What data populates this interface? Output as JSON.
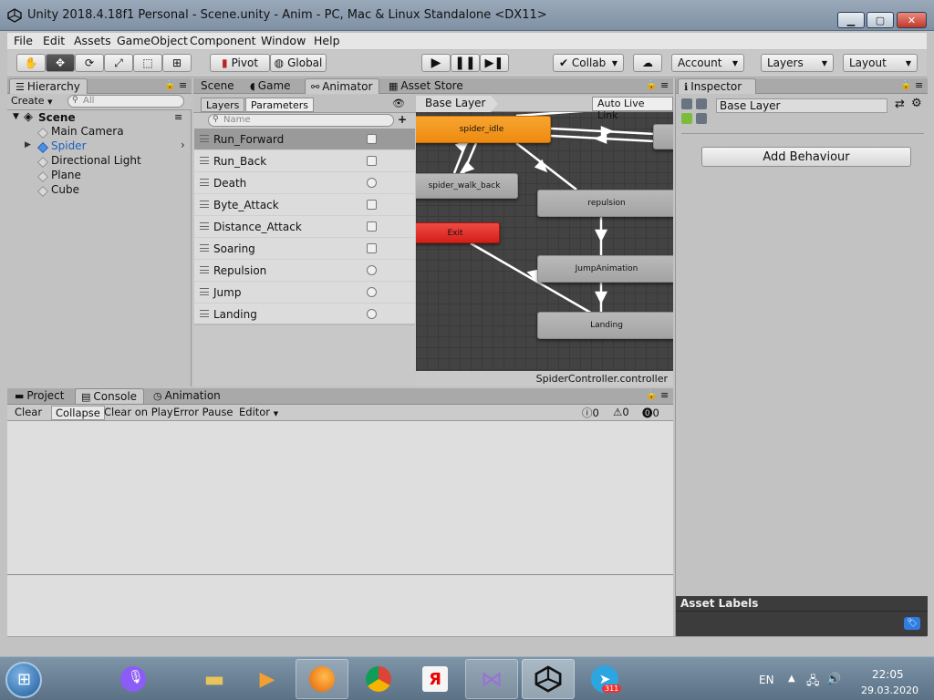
{
  "window": {
    "title": "Unity 2018.4.18f1 Personal - Scene.unity - Anim - PC, Mac & Linux Standalone <DX11>",
    "minimize_icon": "minimize-icon",
    "maximize_icon": "maximize-icon",
    "close_icon": "close-icon"
  },
  "menu": [
    "File",
    "Edit",
    "Assets",
    "GameObject",
    "Component",
    "Window",
    "Help"
  ],
  "toolbar": {
    "tools": [
      "hand-tool-icon",
      "move-tool-icon",
      "rotate-tool-icon",
      "scale-tool-icon",
      "rect-tool-icon",
      "transform-tool-icon"
    ],
    "pivot": "Pivot",
    "global": "Global",
    "collab": "Collab",
    "account": "Account",
    "layers": "Layers",
    "layout": "Layout"
  },
  "hierarchy": {
    "tab": "Hierarchy",
    "create": "Create",
    "search_placeholder": "All",
    "scene": "Scene",
    "items": [
      "Main Camera",
      "Spider",
      "Directional Light",
      "Plane",
      "Cube"
    ]
  },
  "center_tabs": [
    "Scene",
    "Game",
    "Animator",
    "Asset Store"
  ],
  "animator": {
    "subtabs": [
      "Layers",
      "Parameters"
    ],
    "search_placeholder": "Name",
    "breadcrumb": "Base Layer",
    "auto_live_link": "Auto Live Link",
    "controller": "SpiderController.controller",
    "parameters": [
      {
        "name": "Run_Forward",
        "type": "bool"
      },
      {
        "name": "Run_Back",
        "type": "bool"
      },
      {
        "name": "Death",
        "type": "trigger"
      },
      {
        "name": "Byte_Attack",
        "type": "bool"
      },
      {
        "name": "Distance_Attack",
        "type": "bool"
      },
      {
        "name": "Soaring",
        "type": "bool"
      },
      {
        "name": "Repulsion",
        "type": "trigger"
      },
      {
        "name": "Jump",
        "type": "trigger"
      },
      {
        "name": "Landing",
        "type": "trigger"
      }
    ],
    "states": {
      "idle": "spider_idle",
      "walk_back": "spider_walk_back",
      "exit": "Exit",
      "repulsion": "repulsion",
      "jump": "JumpAnimation",
      "landing": "Landing"
    }
  },
  "inspector": {
    "tab": "Inspector",
    "layer_name": "Base Layer",
    "add_behaviour": "Add Behaviour",
    "asset_labels": "Asset Labels"
  },
  "bottom_tabs": [
    "Project",
    "Console",
    "Animation"
  ],
  "console": {
    "buttons": [
      "Clear",
      "Collapse",
      "Clear on Play",
      "Error Pause",
      "Editor"
    ],
    "info_count": "0",
    "warning_count": "0",
    "error_count": "0"
  },
  "taskbar": {
    "language": "EN",
    "time": "22:05",
    "date": "29.03.2020",
    "telegram_badge": "311"
  },
  "colors": {
    "orange_state": "#f39a22",
    "red_state": "#e2322c",
    "selected_param": "#9a9a9a",
    "spider_blue": "#1f5fbf"
  }
}
